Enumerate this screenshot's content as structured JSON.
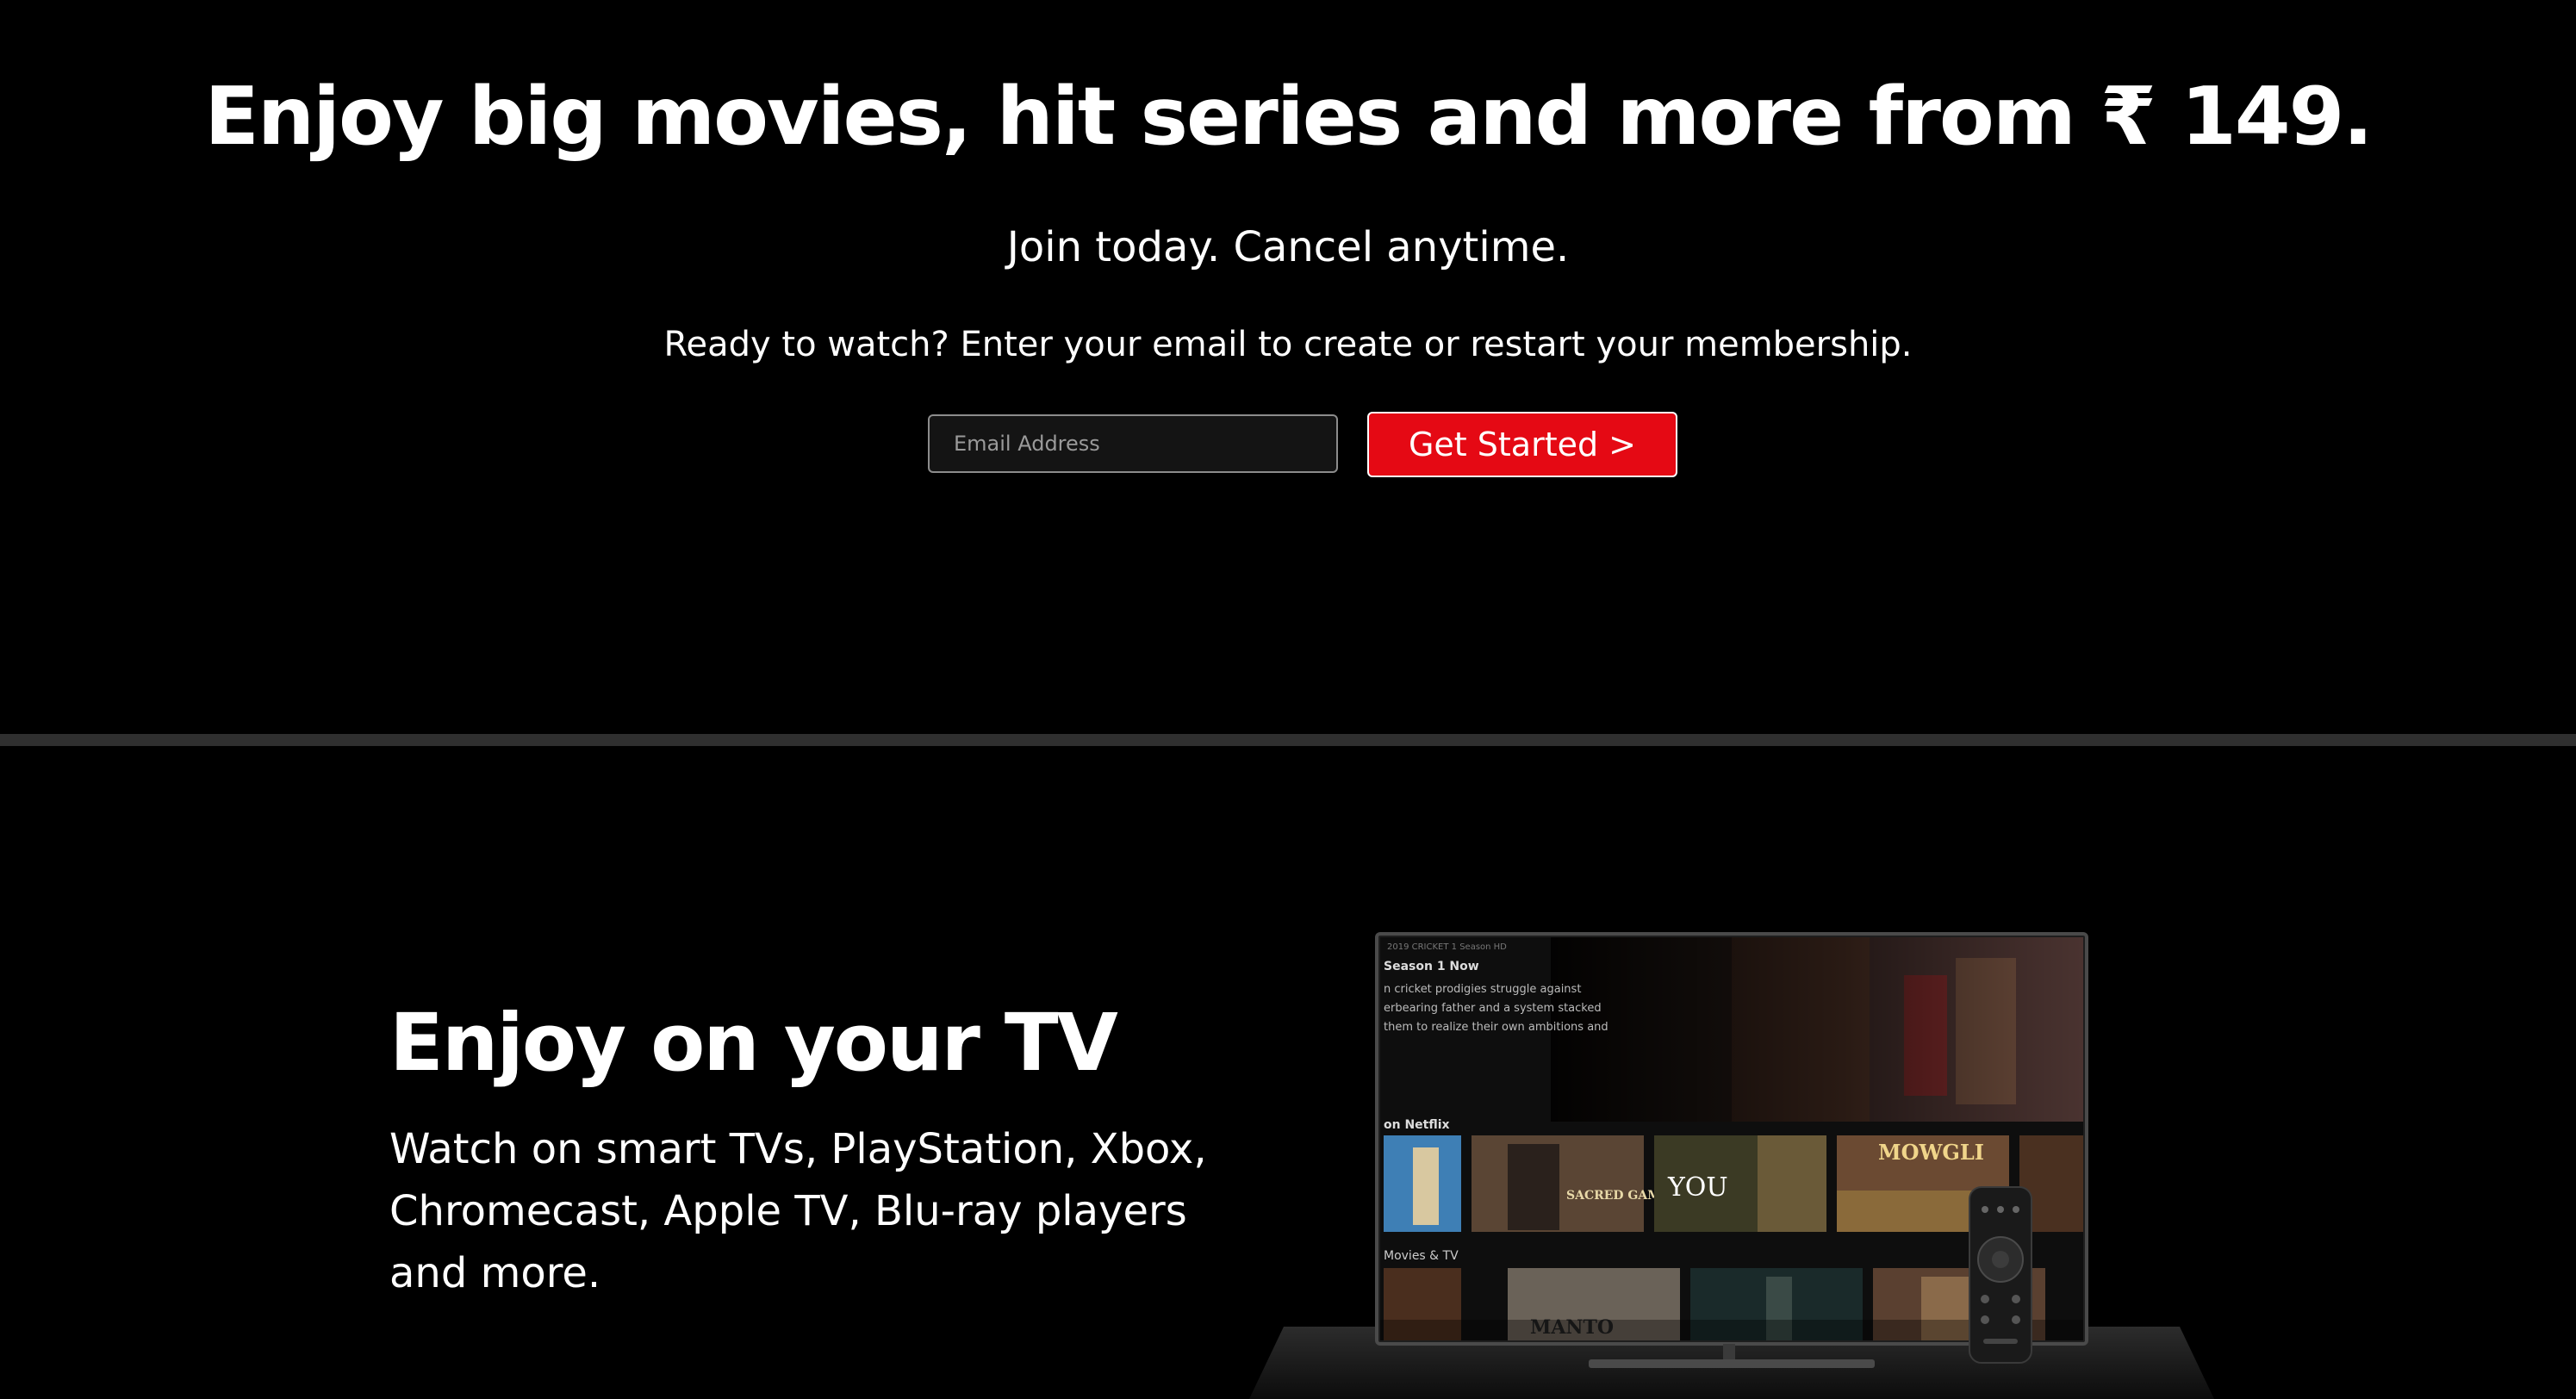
{
  "hero": {
    "title": "Enjoy big movies, hit series and more from ₹ 149.",
    "subtitle": "Join today. Cancel anytime.",
    "cta_text": "Ready to watch? Enter your email to create or restart your membership.",
    "email_placeholder": "Email Address",
    "email_value": "",
    "get_started_label": "Get Started >"
  },
  "feature": {
    "title": "Enjoy on your TV",
    "description": "Watch on smart TVs, PlayStation, Xbox, Chromecast, Apple TV, Blu-ray players and more."
  },
  "tv_screen": {
    "top_bar": "2019  CRICKET  1 Season  HD",
    "season_label": "Season 1 Now",
    "synopsis_lines": [
      "n cricket prodigies struggle against",
      "erbearing father and a system stacked",
      "them to realize their own ambitions and"
    ],
    "row1_label": "on Netflix",
    "row2_label": "Movies & TV",
    "tiles": [
      "",
      "SACRED GAMES",
      "YOU",
      "MOWGLI",
      "",
      "MANTO",
      "",
      ""
    ]
  },
  "colors": {
    "background": "#000000",
    "accent": "#e50914",
    "divider": "#2f2f2f",
    "text": "#ffffff"
  }
}
